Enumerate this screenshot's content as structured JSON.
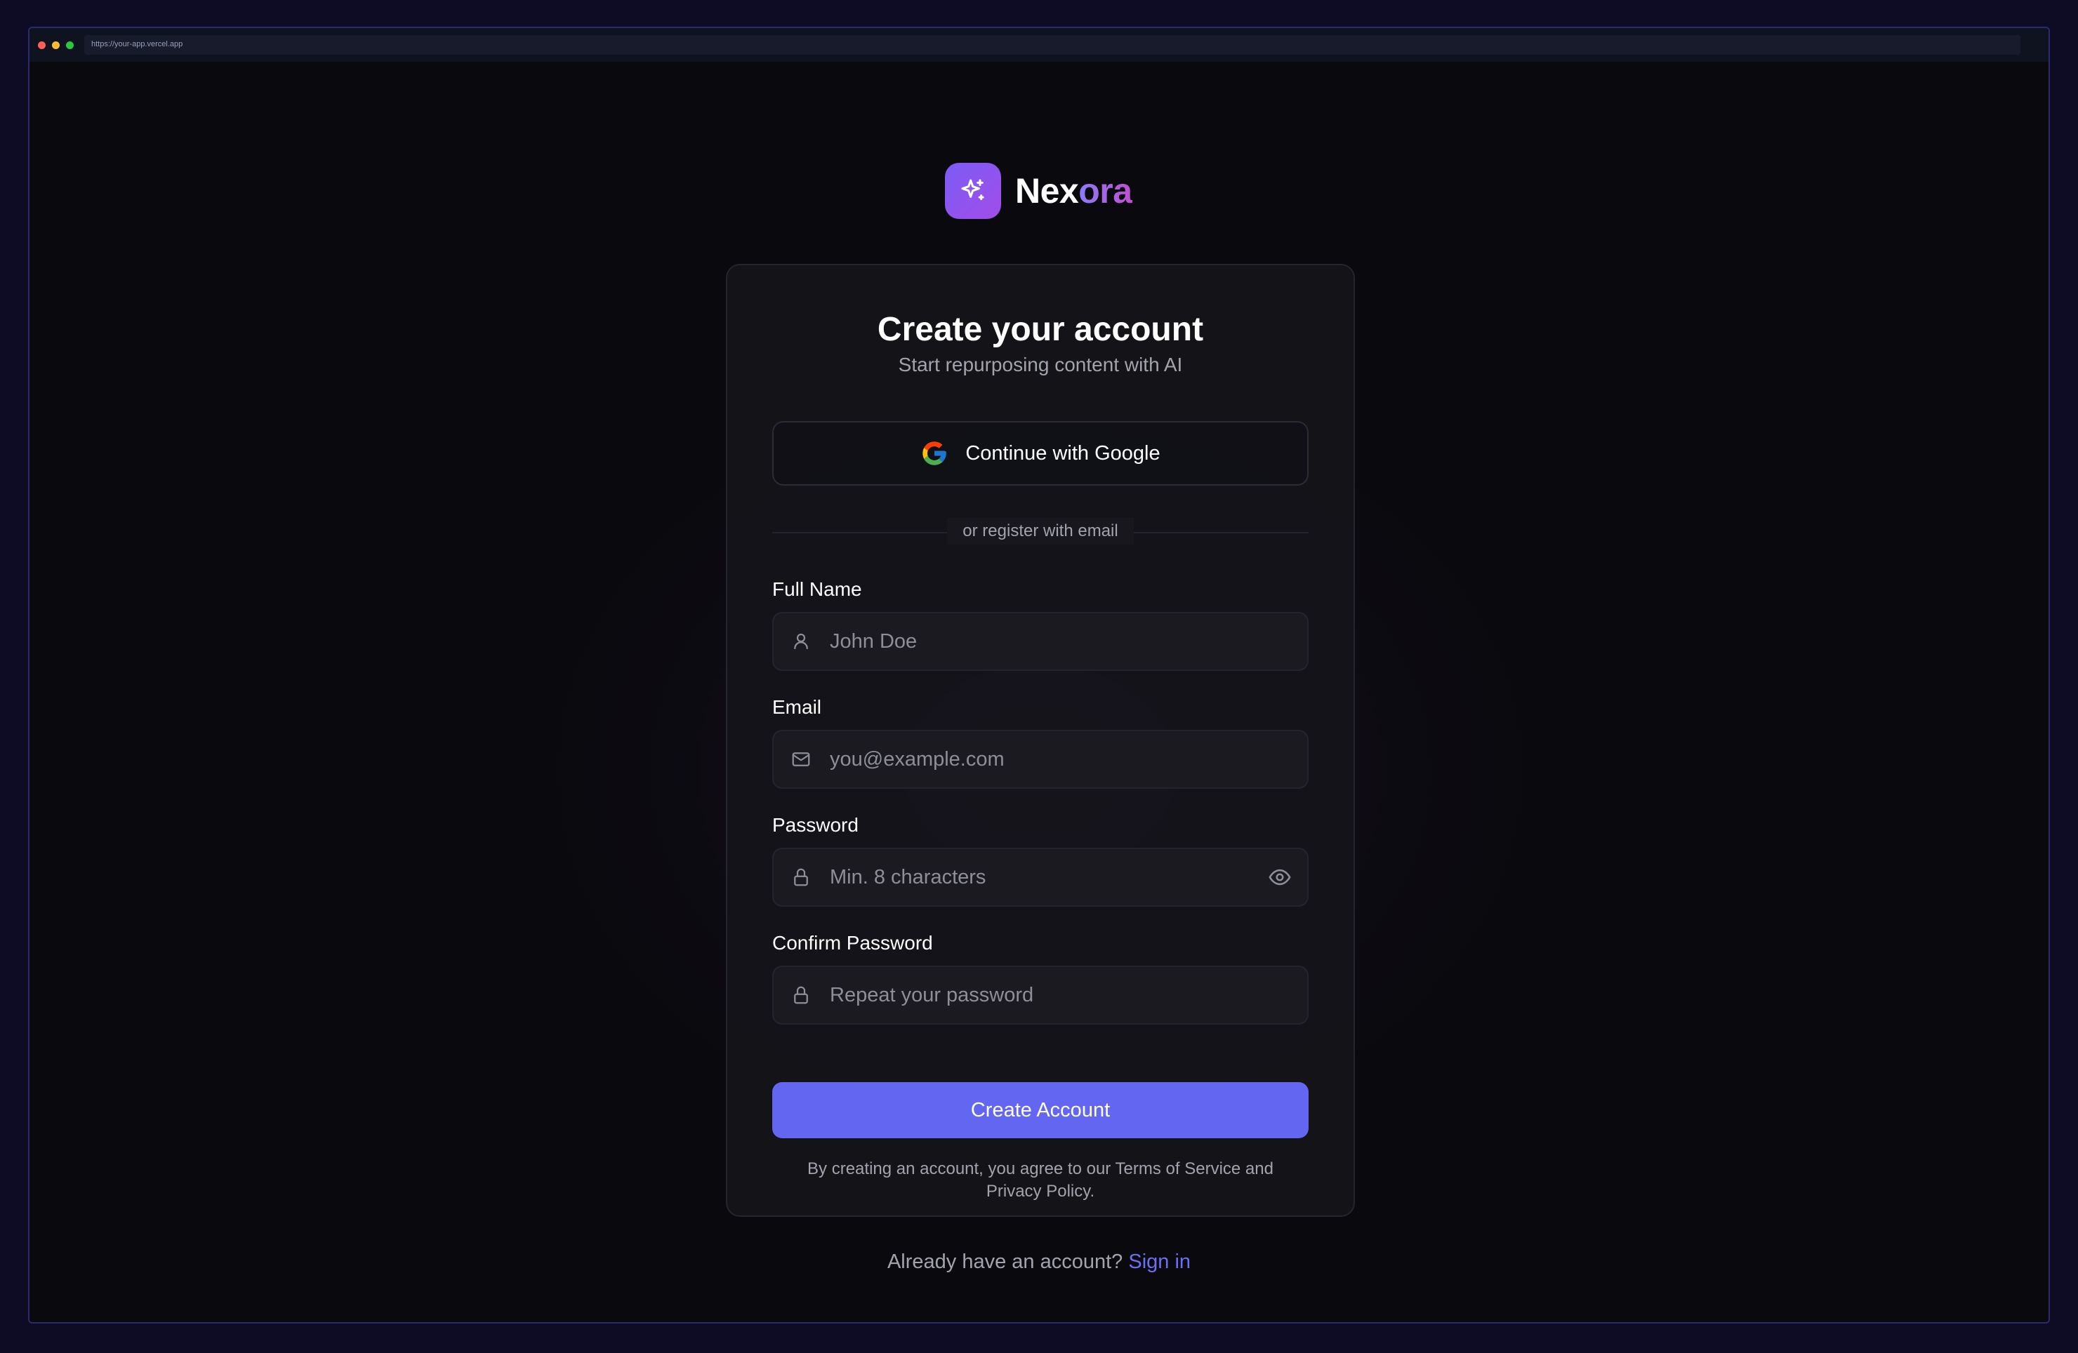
{
  "browser": {
    "url": "https://your-app.vercel.app"
  },
  "brand": {
    "name_part1": "Nex",
    "name_part2": "ora",
    "icon": "sparkles-icon"
  },
  "card": {
    "title": "Create your account",
    "subtitle": "Start repurposing content with AI",
    "google_button": "Continue with Google",
    "divider": "or register with email"
  },
  "form": {
    "full_name": {
      "label": "Full Name",
      "placeholder": "John Doe",
      "icon": "user-icon"
    },
    "email": {
      "label": "Email",
      "placeholder": "you@example.com",
      "icon": "mail-icon"
    },
    "password": {
      "label": "Password",
      "placeholder": "Min. 8 characters",
      "icon": "lock-icon",
      "toggle_icon": "eye-icon"
    },
    "confirm_password": {
      "label": "Confirm Password",
      "placeholder": "Repeat your password",
      "icon": "lock-icon"
    },
    "submit": "Create Account",
    "terms_line1": "By creating an account, you agree to our Terms of Service and",
    "terms_line2": "Privacy Policy."
  },
  "footer": {
    "prompt": "Already have an account?",
    "link": "Sign in"
  },
  "colors": {
    "accent": "#6366f1",
    "background": "#0a0a0e",
    "brand_gradient_start": "#7c5cf6",
    "brand_gradient_end": "#c04fcf"
  }
}
